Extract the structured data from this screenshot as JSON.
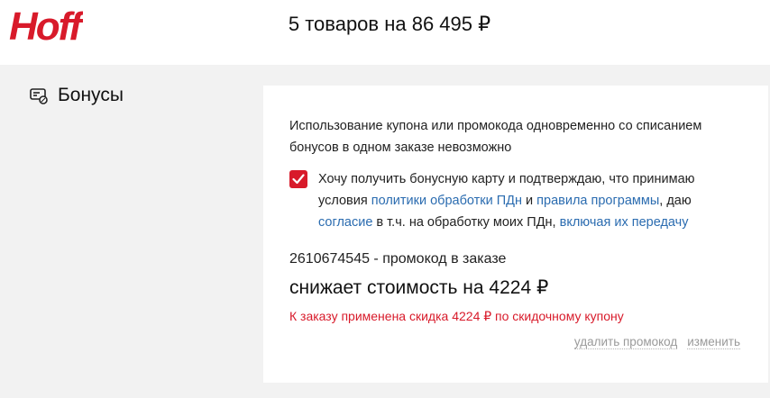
{
  "header": {
    "logo_text": "Hoff",
    "summary": "5 товаров на 86 495 ₽"
  },
  "section": {
    "title": "Бонусы",
    "icon": "bonus-card-icon"
  },
  "card": {
    "notice": "Использование купона или промокода одновременно со списанием бонусов в одном заказе невозможно",
    "consent": {
      "checked": true,
      "text_1": "Хочу получить бонусную карту и подтверждаю, что принимаю условия ",
      "link_policy": "политики обработки ПДн",
      "text_2": " и ",
      "link_rules": "правила программы",
      "text_3": ", даю ",
      "link_consent": "согласие",
      "text_4": " в т.ч. на обработку моих ПДн, ",
      "link_transfer": "включая их передачу"
    },
    "promo_line": "2610674545 - промокод в заказе",
    "discount_line": "снижает стоимость на 4224 ₽",
    "applied_message": "К заказу применена скидка 4224 ₽ по скидочному купону",
    "remove_label": "удалить промокод",
    "change_label": "изменить"
  },
  "colors": {
    "accent": "#d81a2a",
    "link": "#2b6cb0",
    "muted": "#9a9a9a",
    "background": "#f2f2f2"
  }
}
